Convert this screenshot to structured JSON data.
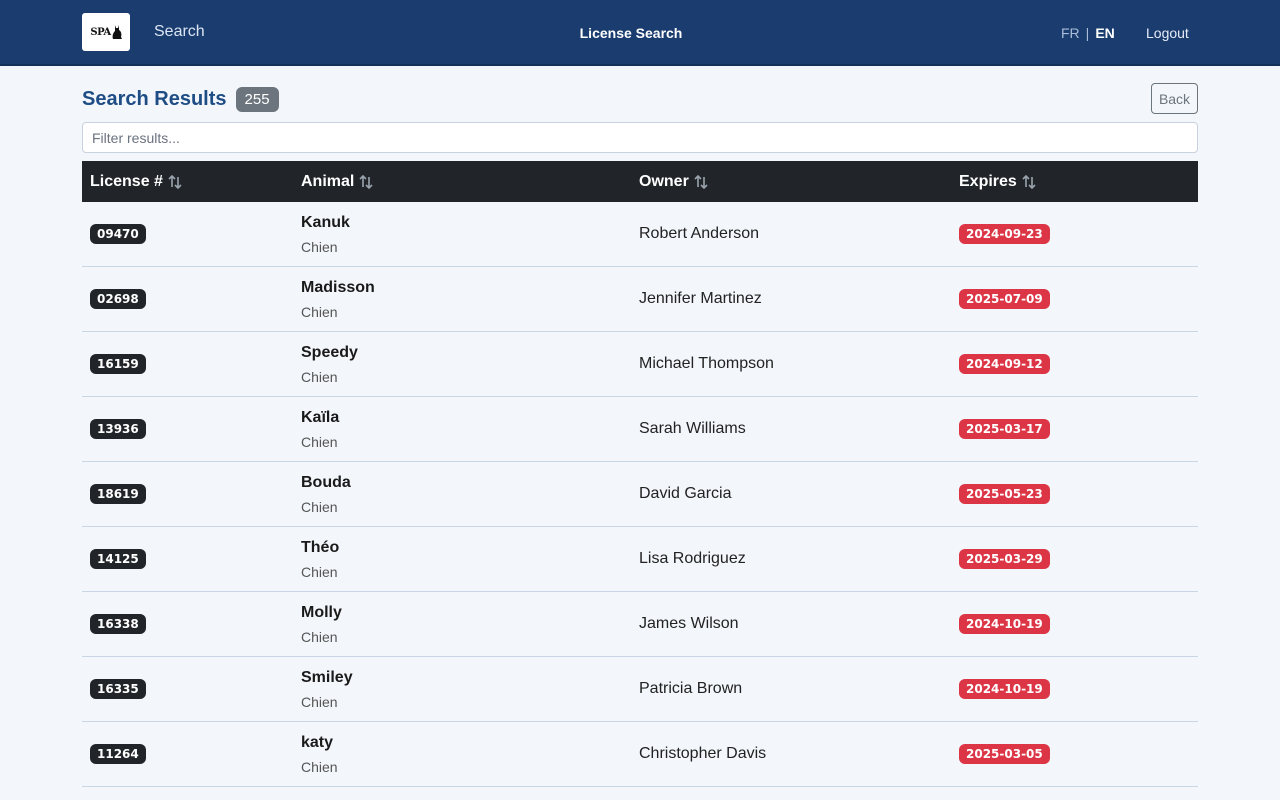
{
  "nav": {
    "logo_text": "SPA",
    "search_link": "Search",
    "title": "License Search",
    "lang_fr": "FR",
    "lang_sep": "|",
    "lang_en": "EN",
    "logout": "Logout"
  },
  "header": {
    "title": "Search Results",
    "count": "255",
    "back_label": "Back"
  },
  "filter": {
    "placeholder": "Filter results...",
    "value": ""
  },
  "table": {
    "columns": [
      "License #",
      "Animal",
      "Owner",
      "Expires"
    ],
    "rows": [
      {
        "license": "09470",
        "animal": "Kanuk",
        "species": "Chien",
        "owner": "Robert Anderson",
        "expires": "2024-09-23"
      },
      {
        "license": "02698",
        "animal": "Madisson",
        "species": "Chien",
        "owner": "Jennifer Martinez",
        "expires": "2025-07-09"
      },
      {
        "license": "16159",
        "animal": "Speedy",
        "species": "Chien",
        "owner": "Michael Thompson",
        "expires": "2024-09-12"
      },
      {
        "license": "13936",
        "animal": "Kaïla",
        "species": "Chien",
        "owner": "Sarah Williams",
        "expires": "2025-03-17"
      },
      {
        "license": "18619",
        "animal": "Bouda",
        "species": "Chien",
        "owner": "David Garcia",
        "expires": "2025-05-23"
      },
      {
        "license": "14125",
        "animal": "Théo",
        "species": "Chien",
        "owner": "Lisa Rodriguez",
        "expires": "2025-03-29"
      },
      {
        "license": "16338",
        "animal": "Molly",
        "species": "Chien",
        "owner": "James Wilson",
        "expires": "2024-10-19"
      },
      {
        "license": "16335",
        "animal": "Smiley",
        "species": "Chien",
        "owner": "Patricia Brown",
        "expires": "2024-10-19"
      },
      {
        "license": "11264",
        "animal": "katy",
        "species": "Chien",
        "owner": "Christopher Davis",
        "expires": "2025-03-05"
      }
    ]
  },
  "colors": {
    "navbar": "#1a3c6e",
    "table_header": "#212529",
    "expired_badge": "#dc3545",
    "count_badge": "#6c757d"
  },
  "icons": {
    "sort": "sort-arrows-icon",
    "logo": "cat-silhouette-icon"
  }
}
